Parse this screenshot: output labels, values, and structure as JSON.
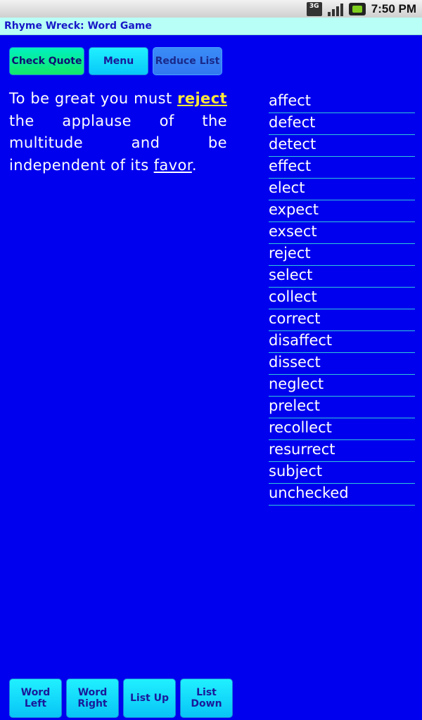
{
  "status_bar": {
    "network": "3G",
    "time": "7:50 PM"
  },
  "app": {
    "title": "Rhyme Wreck: Word Game"
  },
  "toolbar": {
    "check_quote": "Check Quote",
    "menu": "Menu",
    "reduce_list": "Reduce List"
  },
  "quote": {
    "part1": "To be great you must ",
    "highlight": "reject",
    "part2": " the applause of the multitude and be independent of its ",
    "underlined": "favor",
    "part3": "."
  },
  "words": [
    "affect",
    "defect",
    "detect",
    "effect",
    "elect",
    "expect",
    "exsect",
    "reject",
    "select",
    "collect",
    "correct",
    "disaffect",
    "dissect",
    "neglect",
    "prelect",
    "recollect",
    "resurrect",
    "subject",
    "unchecked"
  ],
  "bottom_buttons": {
    "word_left_1": "Word",
    "word_left_2": "Left",
    "word_right_1": "Word",
    "word_right_2": "Right",
    "list_up": "List Up",
    "list_down_1": "List",
    "list_down_2": "Down"
  },
  "colors": {
    "background": "#0000ee",
    "highlight": "#ffe83a",
    "title_bar": "#b8fff7"
  }
}
